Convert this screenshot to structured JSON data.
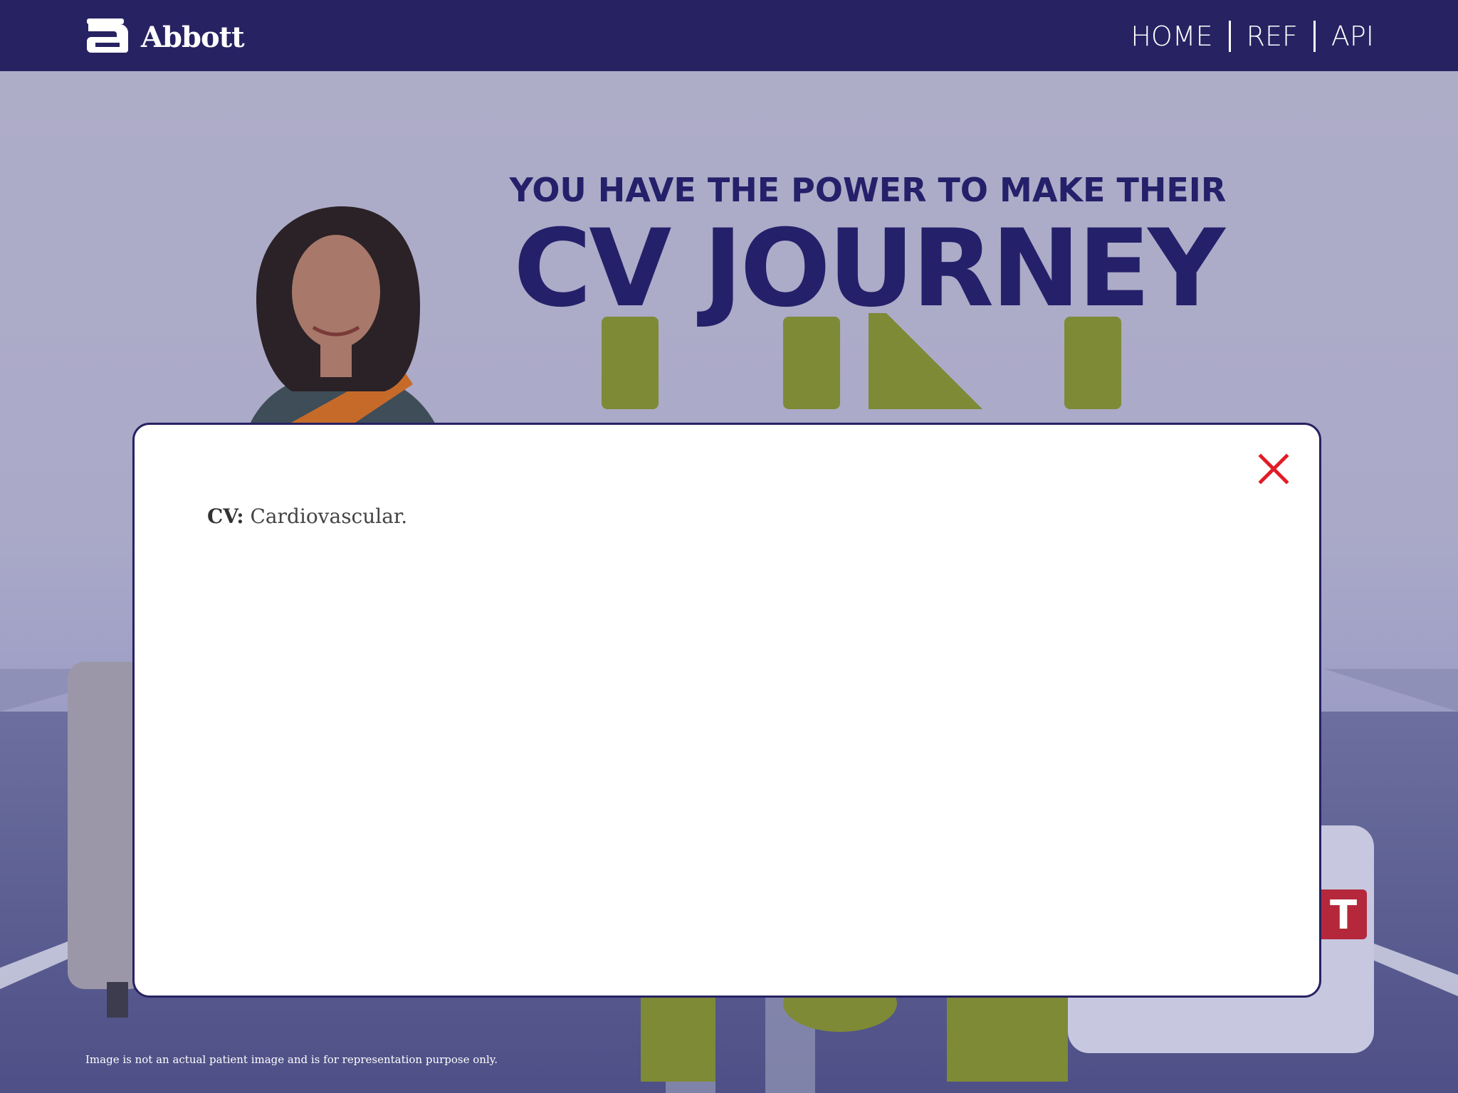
{
  "header": {
    "brand": "Abbott",
    "nav": [
      {
        "label": "HOME"
      },
      {
        "label": "REF"
      },
      {
        "label": "API"
      }
    ]
  },
  "hero": {
    "headline_small": "YOU HAVE THE POWER TO MAKE THEIR",
    "headline_big": "CV JOURNEY",
    "disclaimer": "Image is not an actual patient image and is for representation purpose only."
  },
  "modal": {
    "term": "CV:",
    "definition": "Cardiovascular.",
    "close_icon": "close-x-icon"
  },
  "colors": {
    "brand_navy": "#272262",
    "close_red": "#e11d27",
    "letter_green": "#8a9a2a"
  }
}
